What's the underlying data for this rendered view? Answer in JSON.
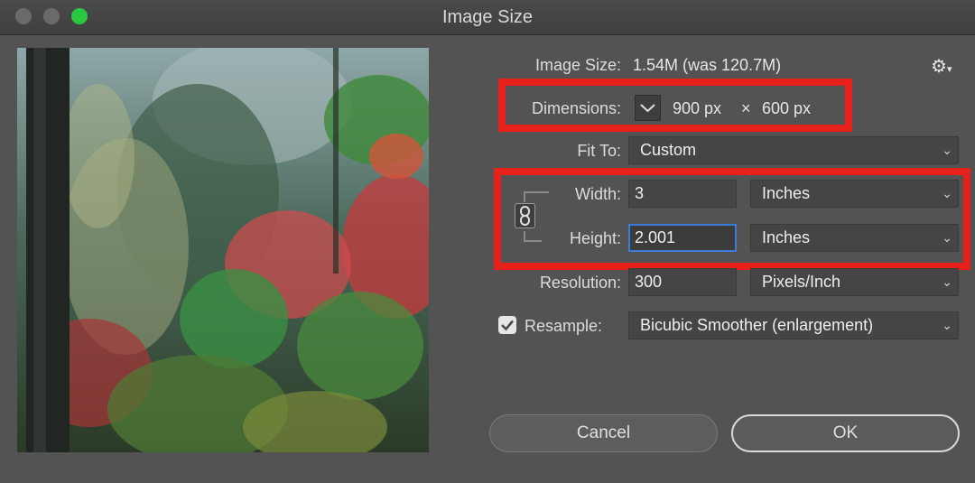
{
  "window": {
    "title": "Image Size"
  },
  "preview": {
    "alt": ""
  },
  "image_size": {
    "label": "Image Size:",
    "value": "1.54M (was 120.7M)"
  },
  "gear_menu": {
    "icon": "gear-icon"
  },
  "dimensions": {
    "label": "Dimensions:",
    "width": "900 px",
    "times": "×",
    "height": "600 px"
  },
  "fit_to": {
    "label": "Fit To:",
    "value": "Custom"
  },
  "width": {
    "label": "Width:",
    "value": "3",
    "unit": "Inches"
  },
  "height": {
    "label": "Height:",
    "value": "2.001",
    "unit": "Inches"
  },
  "resolution": {
    "label": "Resolution:",
    "value": "300",
    "unit": "Pixels/Inch"
  },
  "resample": {
    "label": "Resample:",
    "checked": true,
    "method": "Bicubic Smoother (enlargement)"
  },
  "buttons": {
    "cancel": "Cancel",
    "ok": "OK"
  },
  "colors": {
    "highlight": "#e8201a",
    "focus": "#3d7bd8",
    "traffic_zoom": "#2ac840"
  }
}
